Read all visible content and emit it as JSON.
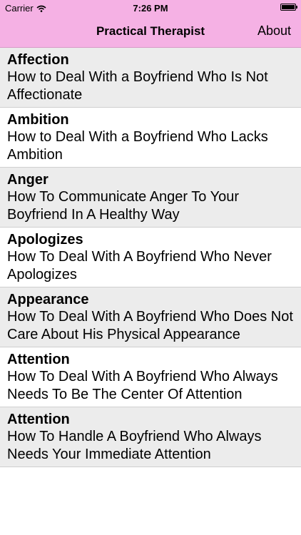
{
  "status_bar": {
    "carrier": "Carrier",
    "time": "7:26 PM",
    "icons": [
      "wifi-icon",
      "battery-icon"
    ]
  },
  "navbar": {
    "title": "Practical Therapist",
    "about_label": "About",
    "background_color": "#f5b1e4"
  },
  "items": [
    {
      "category": "Affection",
      "title": "How to Deal With a Boyfriend Who Is Not Affectionate"
    },
    {
      "category": "Ambition",
      "title": "How to Deal With a Boyfriend Who Lacks Ambition"
    },
    {
      "category": "Anger",
      "title": "How To Communicate Anger To Your Boyfriend In A Healthy Way"
    },
    {
      "category": "Apologizes",
      "title": "How To Deal With A Boyfriend Who Never Apologizes"
    },
    {
      "category": "Appearance",
      "title": "How To Deal With A Boyfriend Who Does Not Care About His Physical Appearance"
    },
    {
      "category": "Attention",
      "title": "How To Deal With A Boyfriend Who Always Needs To Be The Center Of Attention"
    },
    {
      "category": "Attention",
      "title": "How To Handle A Boyfriend Who Always Needs Your Immediate Attention"
    }
  ]
}
